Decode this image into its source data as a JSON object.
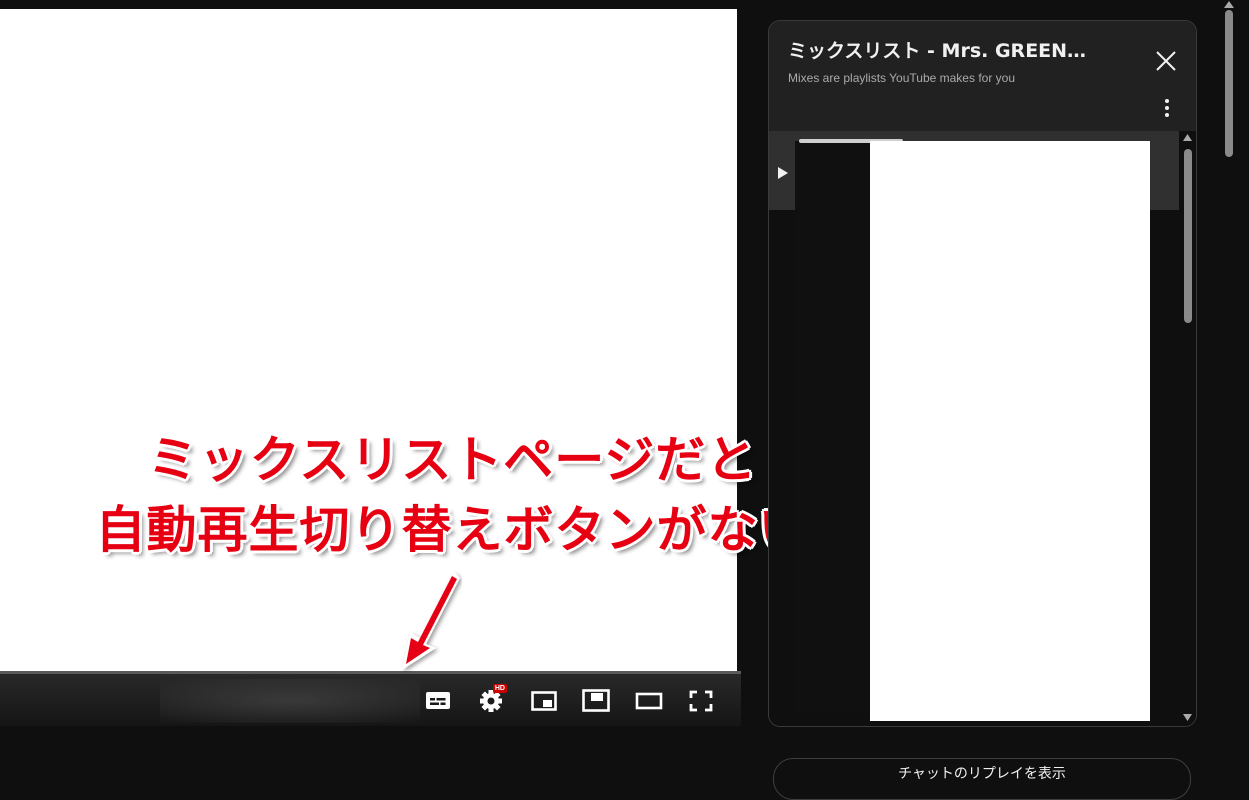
{
  "playlist": {
    "title": "ミックスリスト - Mrs. GREEN…",
    "subtitle": "Mixes are playlists YouTube makes for you",
    "close_icon": "close-icon",
    "more_icon": "more-vert-icon"
  },
  "player": {
    "controls": [
      {
        "name": "subtitles-icon",
        "label": "字幕"
      },
      {
        "name": "settings-icon",
        "label": "設定",
        "badge": "HD"
      },
      {
        "name": "miniplayer-icon",
        "label": "ミニプレーヤー"
      },
      {
        "name": "theater-mode-icon",
        "label": "シアターモード"
      },
      {
        "name": "fullscreen-icon",
        "label": "全画面"
      }
    ]
  },
  "annotation": {
    "line1": "ミックスリストページだと",
    "line2": "自動再生切り替えボタンがない",
    "color": "#e60012"
  },
  "chat": {
    "button_label": "チャットのリプレイを表示"
  }
}
